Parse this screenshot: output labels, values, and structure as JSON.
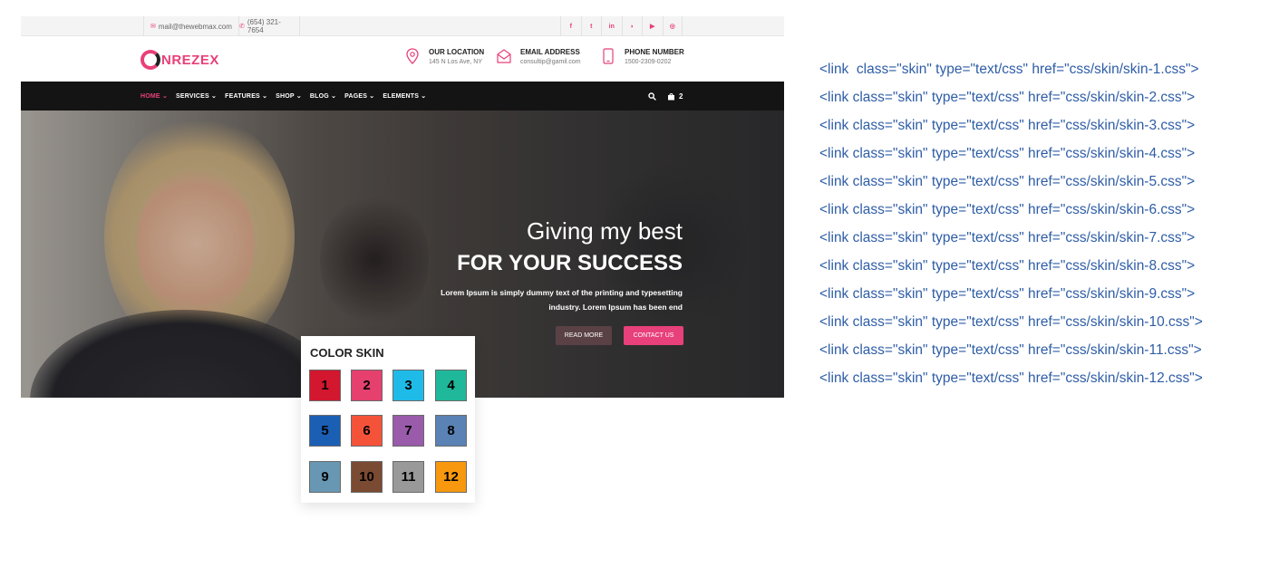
{
  "topbar": {
    "email": "mail@thewebmax.com",
    "phone": "(654) 321-7654",
    "social": [
      "facebook-icon",
      "twitter-icon",
      "linkedin-icon",
      "rss-icon",
      "youtube-icon",
      "instagram-icon"
    ]
  },
  "header": {
    "logo": "NREZEX",
    "location_title": "OUR LOCATION",
    "location_value": "145 N Los Ave, NY",
    "email_title": "EMAIL ADDRESS",
    "email_value": "consultip@gamil.com",
    "phone_title": "PHONE NUMBER",
    "phone_value": "1500-2309-0202"
  },
  "nav": {
    "items": [
      "HOME",
      "SERVICES",
      "FEATURES",
      "SHOP",
      "BLOG",
      "PAGES",
      "ELEMENTS"
    ],
    "cart_count": "2"
  },
  "hero": {
    "heading_light": "Giving my best",
    "heading_bold": "FOR YOUR SUCCESS",
    "text": "Lorem Ipsum is simply dummy text of the printing and typesetting industry. Lorem Ipsum has been end",
    "read_more": "READ MORE",
    "contact_us": "CONTACT US"
  },
  "skin_panel": {
    "title": "COLOR SKIN",
    "swatches": [
      {
        "label": "1",
        "color": "#d2172e"
      },
      {
        "label": "2",
        "color": "#e6406f"
      },
      {
        "label": "3",
        "color": "#1fbbe8"
      },
      {
        "label": "4",
        "color": "#1fb89a"
      },
      {
        "label": "5",
        "color": "#1a5fb4"
      },
      {
        "label": "6",
        "color": "#f4533a"
      },
      {
        "label": "7",
        "color": "#9a5bab"
      },
      {
        "label": "8",
        "color": "#5a82b5"
      },
      {
        "label": "9",
        "color": "#6797b3"
      },
      {
        "label": "10",
        "color": "#7b4a32"
      },
      {
        "label": "11",
        "color": "#999999"
      },
      {
        "label": "12",
        "color": "#f7980f"
      }
    ]
  },
  "code_lines": [
    "<link  class=\"skin\" type=\"text/css\" href=\"css/skin/skin-1.css\">",
    "<link class=\"skin\" type=\"text/css\" href=\"css/skin/skin-2.css\">",
    "<link class=\"skin\" type=\"text/css\" href=\"css/skin/skin-3.css\">",
    "<link class=\"skin\" type=\"text/css\" href=\"css/skin/skin-4.css\">",
    "<link class=\"skin\" type=\"text/css\" href=\"css/skin/skin-5.css\">",
    "<link class=\"skin\" type=\"text/css\" href=\"css/skin/skin-6.css\">",
    "<link class=\"skin\" type=\"text/css\" href=\"css/skin/skin-7.css\">",
    "<link class=\"skin\" type=\"text/css\" href=\"css/skin/skin-8.css\">",
    "<link class=\"skin\" type=\"text/css\" href=\"css/skin/skin-9.css\">",
    "<link class=\"skin\" type=\"text/css\" href=\"css/skin/skin-10.css\">",
    "<link class=\"skin\" type=\"text/css\" href=\"css/skin/skin-11.css\">",
    "<link class=\"skin\" type=\"text/css\" href=\"css/skin/skin-12.css\">"
  ]
}
